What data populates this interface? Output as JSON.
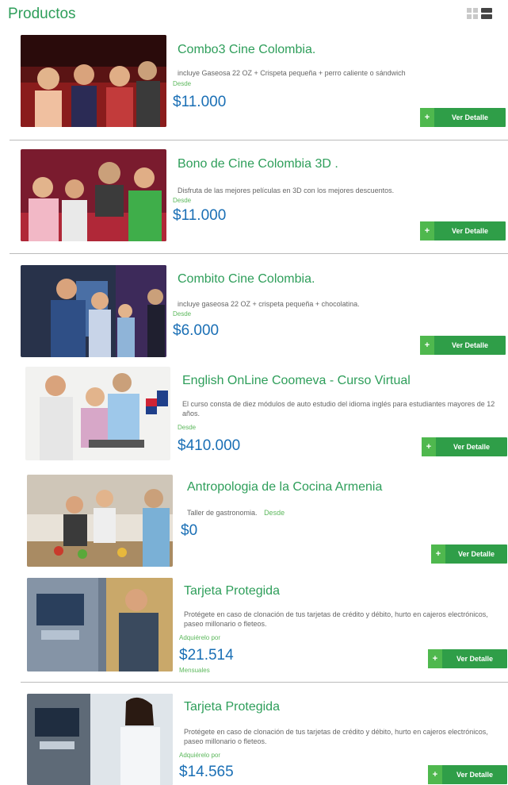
{
  "header": {
    "title": "Productos",
    "grid_view_icon": "grid-view-icon",
    "list_view_icon": "list-view-icon"
  },
  "button_label": "Ver Detalle",
  "button_plus": "+",
  "colors": {
    "green": "#2e9e5a",
    "button": "#2f9e48",
    "price": "#1a6fb5"
  },
  "products": [
    {
      "name": "Combo3 Cine Colombia.",
      "description": "incluye Gaseosa 22 OZ + Crispeta pequeña + perro caliente o sándwich",
      "from": "Desde",
      "price": "$11.000"
    },
    {
      "name": "Bono de Cine Colombia 3D .",
      "description": "Disfruta de las mejores películas en 3D con los mejores descuentos.",
      "from": "Desde",
      "price": "$11.000"
    },
    {
      "name": "Combito Cine Colombia.",
      "description": "incluye gaseosa 22 OZ + crispeta pequeña + chocolatina.",
      "from": "Desde",
      "price": "$6.000"
    },
    {
      "name": "English OnLine Coomeva - Curso Virtual",
      "description": "El curso consta de diez módulos de auto estudio del idioma inglés para estudiantes mayores de 12 años.",
      "from": "Desde",
      "price": "$410.000"
    },
    {
      "name": "Antropologia de la Cocina Armenia",
      "description": "Taller de gastronomia.",
      "from": "Desde",
      "price": "$0"
    },
    {
      "name": "Tarjeta Protegida",
      "description": "Protégete en caso de clonación de tus tarjetas de crédito y débito, hurto en cajeros electrónicos, paseo millonario o fleteos.",
      "from": "Adquiérelo por",
      "price": "$21.514",
      "extra": "Mensuales"
    },
    {
      "name": "Tarjeta Protegida",
      "description": "Protégete en caso de clonación de tus tarjetas de crédito y débito, hurto en cajeros electrónicos, paseo millonario o fleteos.",
      "from": "Adquiérelo por",
      "price": "$14.565"
    }
  ]
}
